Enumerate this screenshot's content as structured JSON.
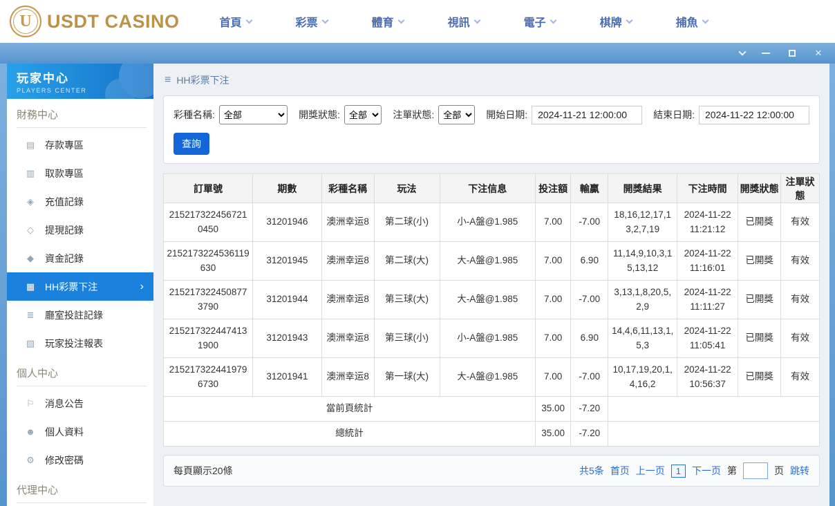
{
  "header": {
    "logo_text": "USDT CASINO",
    "nav": [
      {
        "key": "home",
        "label": "首頁"
      },
      {
        "key": "lottery",
        "label": "彩票"
      },
      {
        "key": "sports",
        "label": "體育"
      },
      {
        "key": "video",
        "label": "視訊"
      },
      {
        "key": "egames",
        "label": "電子"
      },
      {
        "key": "cards",
        "label": "棋牌"
      },
      {
        "key": "fishing",
        "label": "捕魚"
      }
    ]
  },
  "sidebar": {
    "title": "玩家中心",
    "subtitle": "PLAYERS CENTER",
    "sections": [
      {
        "label": "財務中心",
        "items": [
          {
            "key": "deposit",
            "label": "存款專區",
            "icon": "deposit-icon"
          },
          {
            "key": "withdraw",
            "label": "取款專區",
            "icon": "withdraw-icon"
          },
          {
            "key": "recharge-record",
            "label": "充值記錄",
            "icon": "recharge-record-icon"
          },
          {
            "key": "cashout-record",
            "label": "提現記錄",
            "icon": "cashout-record-icon"
          },
          {
            "key": "funds-record",
            "label": "資金記錄",
            "icon": "funds-record-icon"
          },
          {
            "key": "hh-lottery-bets",
            "label": "HH彩票下注",
            "icon": "lottery-bets-icon",
            "active": true
          },
          {
            "key": "room-bets-record",
            "label": "廳室投註記錄",
            "icon": "room-bets-icon"
          },
          {
            "key": "player-bet-report",
            "label": "玩家投注報表",
            "icon": "report-icon"
          }
        ]
      },
      {
        "label": "個人中心",
        "items": [
          {
            "key": "announcements",
            "label": "消息公告",
            "icon": "announcement-icon"
          },
          {
            "key": "profile",
            "label": "個人資料",
            "icon": "profile-icon"
          },
          {
            "key": "change-password",
            "label": "修改密碼",
            "icon": "password-icon"
          }
        ]
      },
      {
        "label": "代理中心",
        "items": []
      }
    ]
  },
  "breadcrumb": "HH彩票下注",
  "filters": {
    "lottery_label": "彩種名稱:",
    "lottery_value": "全部",
    "draw_status_label": "開獎狀態:",
    "draw_status_value": "全部",
    "order_status_label": "注單狀態:",
    "order_status_value": "全部",
    "start_label": "開始日期:",
    "start_value": "2024-11-21 12:00:00",
    "end_label": "結束日期:",
    "end_value": "2024-11-22 12:00:00",
    "search_button": "查詢"
  },
  "table": {
    "headers": [
      "訂單號",
      "期數",
      "彩種名稱",
      "玩法",
      "下注信息",
      "投注額",
      "輸贏",
      "開獎結果",
      "下注時間",
      "開獎狀態",
      "注單狀態"
    ],
    "rows": [
      {
        "order": "2152173224567210450",
        "period": "31201946",
        "lottery": "澳洲幸运8",
        "play": "第二球(小)",
        "info": "小-A盤@1.985",
        "amount": "7.00",
        "winloss": "-7.00",
        "result": "18,16,12,17,13,2,7,19",
        "time": "2024-11-22 11:21:12",
        "draw_status": "已開獎",
        "order_status": "有效"
      },
      {
        "order": "2152173224536119630",
        "period": "31201945",
        "lottery": "澳洲幸运8",
        "play": "第二球(大)",
        "info": "大-A盤@1.985",
        "amount": "7.00",
        "winloss": "6.90",
        "result": "11,14,9,10,3,15,13,12",
        "time": "2024-11-22 11:16:01",
        "draw_status": "已開獎",
        "order_status": "有效"
      },
      {
        "order": "2152173224508773790",
        "period": "31201944",
        "lottery": "澳洲幸运8",
        "play": "第三球(大)",
        "info": "大-A盤@1.985",
        "amount": "7.00",
        "winloss": "-7.00",
        "result": "3,13,1,8,20,5,2,9",
        "time": "2024-11-22 11:11:27",
        "draw_status": "已開獎",
        "order_status": "有效"
      },
      {
        "order": "2152173224474131900",
        "period": "31201943",
        "lottery": "澳洲幸运8",
        "play": "第三球(小)",
        "info": "小-A盤@1.985",
        "amount": "7.00",
        "winloss": "6.90",
        "result": "14,4,6,11,13,1,5,3",
        "time": "2024-11-22 11:05:41",
        "draw_status": "已開獎",
        "order_status": "有效"
      },
      {
        "order": "2152173224419796730",
        "period": "31201941",
        "lottery": "澳洲幸运8",
        "play": "第一球(大)",
        "info": "大-A盤@1.985",
        "amount": "7.00",
        "winloss": "-7.00",
        "result": "10,17,19,20,1,4,16,2",
        "time": "2024-11-22 10:56:37",
        "draw_status": "已開獎",
        "order_status": "有效"
      }
    ],
    "summaries": [
      {
        "label": "當前頁統計",
        "amount": "35.00",
        "winloss": "-7.20"
      },
      {
        "label": "總統計",
        "amount": "35.00",
        "winloss": "-7.20"
      }
    ]
  },
  "pagination": {
    "per_page": "每頁顯示20條",
    "total": "共5条",
    "first": "首页",
    "prev": "上一页",
    "current": "1",
    "next": "下一页",
    "page_prefix": "第",
    "page_suffix": "页",
    "jump": "跳转"
  },
  "icons": {
    "deposit-icon": "▤",
    "withdraw-icon": "▥",
    "recharge-record-icon": "◈",
    "cashout-record-icon": "◇",
    "funds-record-icon": "◆",
    "lottery-bets-icon": "▦",
    "room-bets-icon": "≣",
    "report-icon": "▧",
    "announcement-icon": "⚐",
    "profile-icon": "☻",
    "password-icon": "⚙",
    "hamburger": "≡"
  },
  "colors": {
    "accent_blue": "#1a82dd",
    "nav_blue": "#4a6cb3",
    "gold": "#bd9247",
    "link_blue": "#2a6fd1",
    "titlebar_blue": "#5694cd"
  }
}
